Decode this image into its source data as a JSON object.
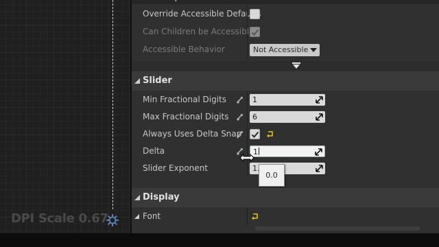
{
  "viewport": {
    "dpi_label": "DPI Scale 0.67",
    "gear_icon": "gear-icon"
  },
  "accessibility": {
    "override_label": "Override Accessible Defaults",
    "override_checked": false,
    "children_label": "Can Children be Accessible",
    "children_checked": true,
    "behavior_label": "Accessible Behavior",
    "behavior_value": "Not Accessible"
  },
  "slider": {
    "section_title": "Slider",
    "min_digits_label": "Min Fractional Digits",
    "min_digits_value": "1",
    "max_digits_label": "Max Fractional Digits",
    "max_digits_value": "6",
    "delta_snap_label": "Always Uses Delta Snap",
    "delta_snap_checked": true,
    "delta_label": "Delta",
    "delta_value": "1",
    "exponent_label": "Slider Exponent",
    "exponent_value": "1.",
    "tooltip_value": "0.0"
  },
  "display": {
    "section_title": "Display",
    "font_label": "Font"
  },
  "colors": {
    "panel_bg": "#303030",
    "section_bg": "#3a3a3a",
    "field_bg": "#d9d9d9",
    "reset_arrow": "#e8c020"
  }
}
